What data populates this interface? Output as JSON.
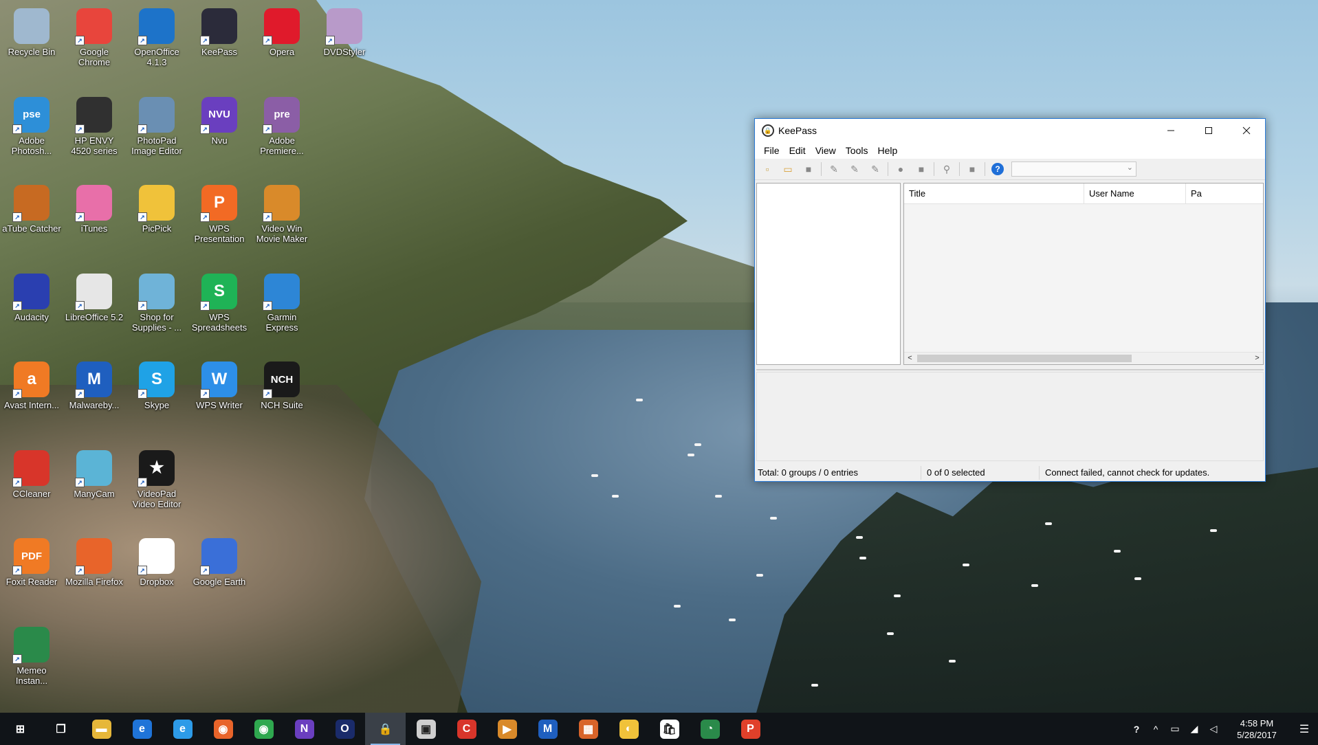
{
  "desktop": {
    "icons": [
      {
        "label": "Recycle Bin",
        "icon": "recycle-bin-icon",
        "color": "#9fb8cf"
      },
      {
        "label": "Google Chrome",
        "icon": "chrome-icon",
        "color": "#e8453c"
      },
      {
        "label": "OpenOffice 4.1.3",
        "icon": "openoffice-icon",
        "color": "#1d73c9"
      },
      {
        "label": "KeePass",
        "icon": "keepass-icon",
        "color": "#2b2b3a"
      },
      {
        "label": "Opera",
        "icon": "opera-icon",
        "color": "#e01a2b"
      },
      {
        "label": "DVDStyler",
        "icon": "dvdstyler-icon",
        "color": "#b89ac9"
      },
      {
        "label": "Adobe Photosh...",
        "icon": "photoshop-elements-icon",
        "color": "#2d8fd8",
        "glyph": "pse"
      },
      {
        "label": "HP ENVY 4520 series",
        "icon": "printer-icon",
        "color": "#303030"
      },
      {
        "label": "PhotoPad Image Editor",
        "icon": "photopad-icon",
        "color": "#6a8fb3"
      },
      {
        "label": "Nvu",
        "icon": "nvu-icon",
        "color": "#6a3fbf",
        "glyph": "NVU"
      },
      {
        "label": "Adobe Premiere...",
        "icon": "premiere-elements-icon",
        "color": "#8b5ea6",
        "glyph": "pre"
      },
      {
        "label": "aTube Catcher",
        "icon": "atube-catcher-icon",
        "color": "#c76a22"
      },
      {
        "label": "iTunes",
        "icon": "itunes-icon",
        "color": "#e86fa9"
      },
      {
        "label": "PicPick",
        "icon": "picpick-icon",
        "color": "#f0c23a"
      },
      {
        "label": "WPS Presentation",
        "icon": "wps-presentation-icon",
        "color": "#f26a24",
        "glyph": "P"
      },
      {
        "label": "Video Win Movie Maker",
        "icon": "video-maker-icon",
        "color": "#d98a2a"
      },
      {
        "label": "Audacity",
        "icon": "audacity-icon",
        "color": "#2a3fb0"
      },
      {
        "label": "LibreOffice 5.2",
        "icon": "libreoffice-icon",
        "color": "#e6e6e6"
      },
      {
        "label": "Shop for Supplies - ...",
        "icon": "shop-supplies-icon",
        "color": "#6fb3d8"
      },
      {
        "label": "WPS Spreadsheets",
        "icon": "wps-spreadsheets-icon",
        "color": "#1fb356",
        "glyph": "S"
      },
      {
        "label": "Garmin Express",
        "icon": "garmin-icon",
        "color": "#2d86d6"
      },
      {
        "label": "Avast Intern...",
        "icon": "avast-icon",
        "color": "#f07a24",
        "glyph": "a"
      },
      {
        "label": "Malwareby...",
        "icon": "malwarebytes-icon",
        "color": "#1f5fbf",
        "glyph": "M"
      },
      {
        "label": "Skype",
        "icon": "skype-icon",
        "color": "#1fa2e6",
        "glyph": "S"
      },
      {
        "label": "WPS Writer",
        "icon": "wps-writer-icon",
        "color": "#2d8fe8",
        "glyph": "W"
      },
      {
        "label": "NCH Suite",
        "icon": "nch-suite-icon",
        "color": "#1a1a1a",
        "glyph": "NCH"
      },
      {
        "label": "CCleaner",
        "icon": "ccleaner-icon",
        "color": "#d8352a"
      },
      {
        "label": "ManyCam",
        "icon": "manycam-icon",
        "color": "#5bb4d6"
      },
      {
        "label": "VideoPad Video Editor",
        "icon": "videopad-icon",
        "color": "#1a1a1a",
        "glyph": "★"
      },
      {
        "label": "Foxit Reader",
        "icon": "foxit-reader-icon",
        "color": "#f07a24",
        "glyph": "PDF"
      },
      {
        "label": "Mozilla Firefox",
        "icon": "firefox-icon",
        "color": "#e8642a"
      },
      {
        "label": "Dropbox",
        "icon": "dropbox-icon",
        "color": "#ffffff"
      },
      {
        "label": "Google Earth",
        "icon": "google-earth-icon",
        "color": "#3a6fd8"
      },
      {
        "label": "Memeo Instan...",
        "icon": "memeo-icon",
        "color": "#2a8a4a"
      }
    ]
  },
  "keepass": {
    "title": "KeePass",
    "menu": [
      "File",
      "Edit",
      "View",
      "Tools",
      "Help"
    ],
    "toolbar": [
      {
        "icon": "new-database-icon",
        "glyph": "▫"
      },
      {
        "icon": "open-database-icon",
        "glyph": "▭"
      },
      {
        "icon": "save-database-icon",
        "glyph": "■"
      },
      {
        "icon": "add-entry-icon",
        "glyph": "✎"
      },
      {
        "icon": "edit-entry-icon",
        "glyph": "✎"
      },
      {
        "icon": "delete-entry-icon",
        "glyph": "✎"
      },
      {
        "icon": "copy-username-icon",
        "glyph": "●"
      },
      {
        "icon": "copy-password-icon",
        "glyph": "■"
      },
      {
        "icon": "find-icon",
        "glyph": "⚲"
      },
      {
        "icon": "lock-workspace-icon",
        "glyph": "■"
      },
      {
        "icon": "help-icon",
        "glyph": "?"
      }
    ],
    "quick_search_value": "",
    "columns": [
      "Title",
      "User Name",
      "Pa"
    ],
    "status": {
      "total": "Total: 0 groups / 0 entries",
      "selected": "0 of 0 selected",
      "message": "Connect failed, cannot check for updates."
    },
    "colors": {
      "accent": "#2b7bd8",
      "help": "#1f6fd8"
    }
  },
  "taskbar": {
    "items": [
      {
        "icon": "start-icon",
        "glyph": "⊞",
        "color": "#101418"
      },
      {
        "icon": "task-view-icon",
        "glyph": "❐",
        "color": "#101418"
      },
      {
        "icon": "file-explorer-icon",
        "glyph": "▬",
        "color": "#e6b73a"
      },
      {
        "icon": "edge-icon",
        "glyph": "e",
        "color": "#1f74d8"
      },
      {
        "icon": "internet-explorer-icon",
        "glyph": "e",
        "color": "#2d9be8"
      },
      {
        "icon": "firefox-icon",
        "glyph": "◉",
        "color": "#e8642a"
      },
      {
        "icon": "chrome-icon",
        "glyph": "◉",
        "color": "#2fa84f"
      },
      {
        "icon": "nvu-icon",
        "glyph": "N",
        "color": "#6a3fbf"
      },
      {
        "icon": "opera-icon",
        "glyph": "O",
        "color": "#1a2b6a"
      },
      {
        "icon": "keepass-icon",
        "glyph": "🔒",
        "color": "#3a4048",
        "active": true
      },
      {
        "icon": "screen-icon",
        "glyph": "▣",
        "color": "#cfcfcf"
      },
      {
        "icon": "ccleaner-icon",
        "glyph": "C",
        "color": "#d8352a"
      },
      {
        "icon": "video-maker-icon",
        "glyph": "▶",
        "color": "#d98a2a"
      },
      {
        "icon": "malwarebytes-icon",
        "glyph": "M",
        "color": "#1f5fbf"
      },
      {
        "icon": "office-icon",
        "glyph": "▦",
        "color": "#d8642a"
      },
      {
        "icon": "picpick-icon",
        "glyph": "◐",
        "color": "#f0c23a"
      },
      {
        "icon": "store-icon",
        "glyph": "🛍",
        "color": "#ffffff"
      },
      {
        "icon": "memeo-icon",
        "glyph": "◔",
        "color": "#2a8a4a"
      },
      {
        "icon": "wps-presentation-icon",
        "glyph": "P",
        "color": "#e0402a"
      }
    ],
    "tray": [
      {
        "icon": "help-tray-icon",
        "glyph": "?"
      },
      {
        "icon": "show-hidden-icons-icon",
        "glyph": "^"
      },
      {
        "icon": "battery-icon",
        "glyph": "▭"
      },
      {
        "icon": "wifi-icon",
        "glyph": "◢"
      },
      {
        "icon": "volume-icon",
        "glyph": "◁"
      }
    ],
    "time": "4:58 PM",
    "date": "5/28/2017"
  }
}
